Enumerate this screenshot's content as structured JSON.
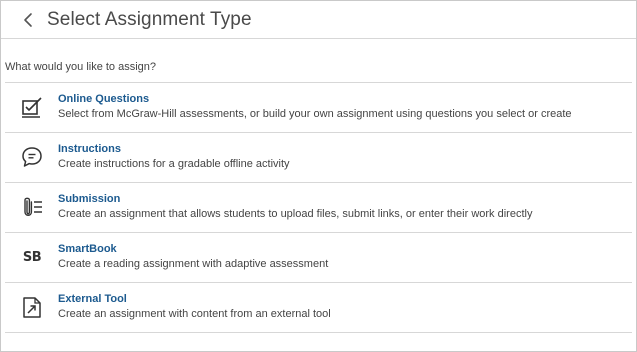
{
  "header": {
    "title": "Select Assignment Type",
    "back_icon": "chevron-left-icon"
  },
  "prompt": "What would you like to assign?",
  "items": [
    {
      "icon": "checkbox-edit-icon",
      "name": "Online Questions",
      "description": "Select from McGraw-Hill assessments, or build your own assignment using questions you select or create"
    },
    {
      "icon": "speech-bubble-icon",
      "name": "Instructions",
      "description": "Create instructions for a gradable offline activity"
    },
    {
      "icon": "attachment-list-icon",
      "name": "Submission",
      "description": "Create an assignment that allows students to upload files, submit links, or enter their work directly"
    },
    {
      "icon": "smartbook-icon",
      "icon_text": "SB",
      "name": "SmartBook",
      "description": "Create a reading assignment with adaptive assessment"
    },
    {
      "icon": "external-link-icon",
      "name": "External Tool",
      "description": "Create an assignment with content from an external tool"
    }
  ]
}
